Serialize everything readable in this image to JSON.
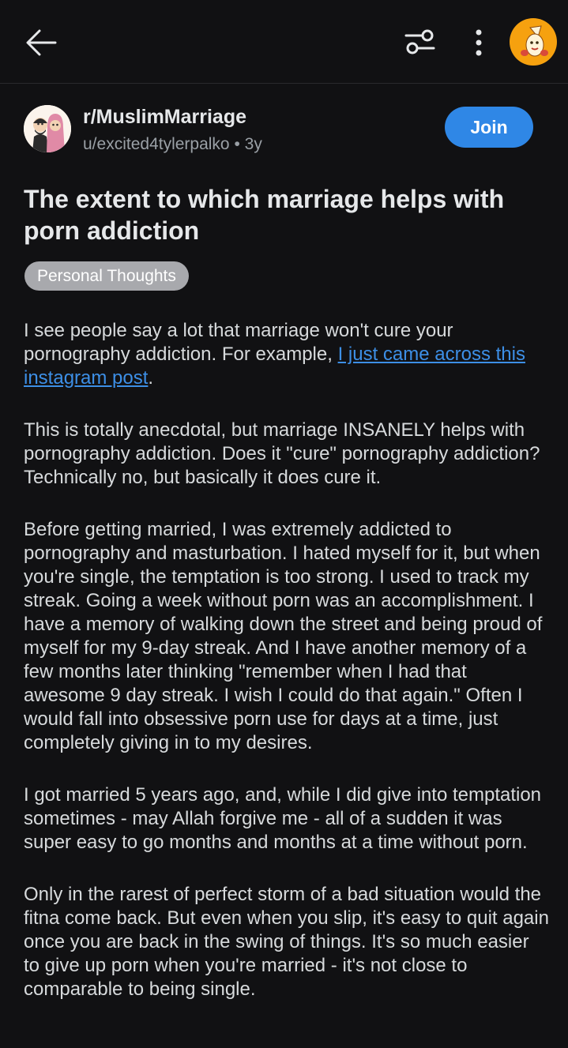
{
  "header": {
    "back_icon": "arrow-left-icon",
    "filter_icon": "sliders-icon",
    "more_icon": "vertical-dots-icon",
    "user_avatar": "user-avatar-orange"
  },
  "post": {
    "subreddit": "r/MuslimMarriage",
    "author": "u/excited4tylerpalko",
    "separator": "•",
    "age": "3y",
    "join_label": "Join",
    "title": "The extent to which marriage helps with porn addiction",
    "flair": "Personal Thoughts",
    "p1_text": "I see people say a lot that marriage won't cure your pornography addiction. For example, ",
    "p1_link": "I just came across this instagram post",
    "p1_end": ".",
    "p2": "This is totally anecdotal, but marriage INSANELY helps with pornography addiction. Does it \"cure\" pornography addiction? Technically no, but basically it does cure it.",
    "p3": "Before getting married, I was extremely addicted to pornography and masturbation. I hated myself for it, but when you're single, the temptation is too strong. I used to track my streak. Going a week without porn was an accomplishment. I have a memory of walking down the street and being proud of myself for my 9-day streak. And I have another memory of a few months later thinking \"remember when I had that awesome 9 day streak. I wish I could do that again.\" Often I would fall into obsessive porn use for days at a time, just completely giving in to my desires.",
    "p4": "I got married 5 years ago, and, while I did give into temptation sometimes - may Allah forgive me - all of a sudden it was super easy to go months and months at a time without porn.",
    "p5": "Only in the rarest of perfect storm of a bad situation would the fitna come back. But even when you slip, it's easy to quit again once you are back in the swing of things. It's so much easier to give up porn when you're married - it's not close to comparable to being single."
  },
  "colors": {
    "background": "#111113",
    "join": "#2f87e6",
    "link": "#3d8fe6",
    "flair": "#a8a9ad",
    "avatar": "#f6a10f"
  }
}
